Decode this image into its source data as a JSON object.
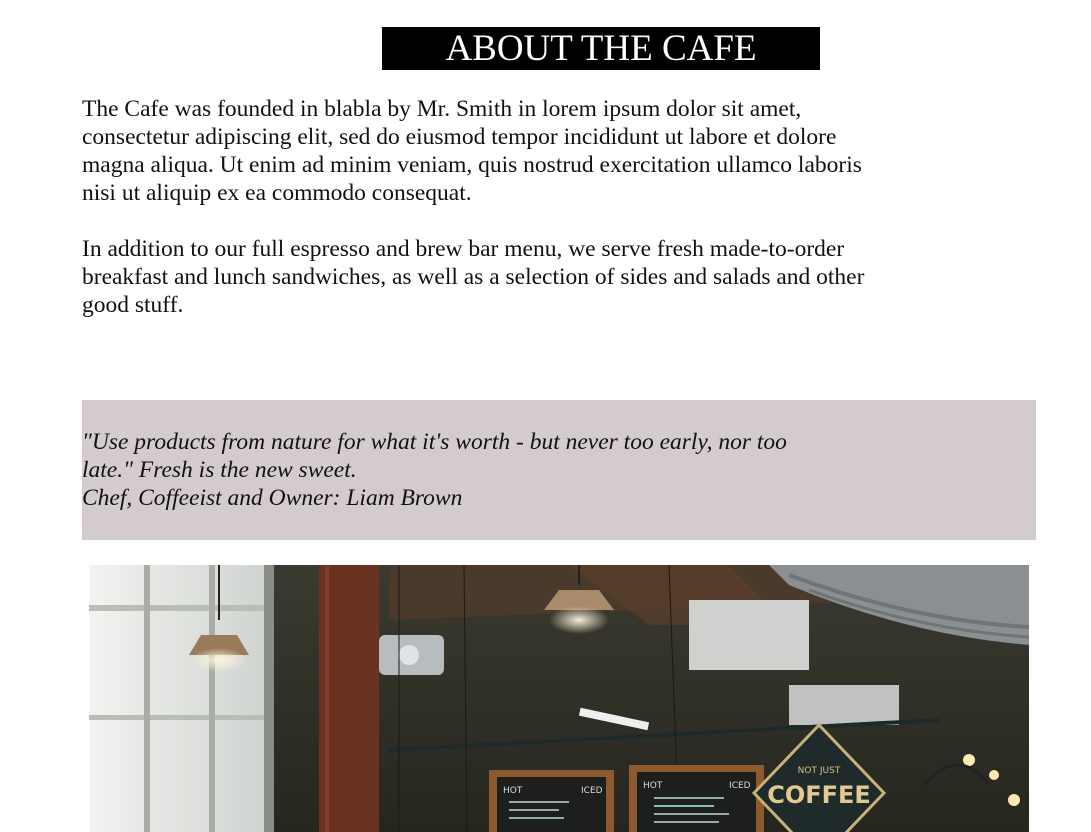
{
  "header": {
    "title": "ABOUT THE CAFE"
  },
  "about": {
    "paragraphs": [
      "The Cafe was founded in blabla by Mr. Smith in lorem ipsum dolor sit amet, consectetur adipiscing elit, sed do eiusmod tempor incididunt ut labore et dolore magna aliqua. Ut enim ad minim veniam, quis nostrud exercitation ullamco laboris nisi ut aliquip ex ea commodo consequat.",
      "In addition to our full espresso and brew bar menu, we serve fresh made-to-order breakfast and lunch sandwiches, as well as a selection of sides and salads and other good stuff."
    ]
  },
  "quote": {
    "line1": "\"Use products from nature for what it's worth - but never too early, nor too late.\" Fresh is the new sweet.",
    "attribution": "Chef, Coffeeist and Owner: Liam Brown"
  },
  "photo": {
    "sign_line1": "NOT JUST",
    "sign_line2": "COFFEE",
    "board1_header": "HOT",
    "board1_header2": "ICED",
    "board2_header": "HOT",
    "board2_header2": "ICED"
  },
  "colors": {
    "title_bg": "#000000",
    "quote_bg": "#d3cbcc"
  }
}
